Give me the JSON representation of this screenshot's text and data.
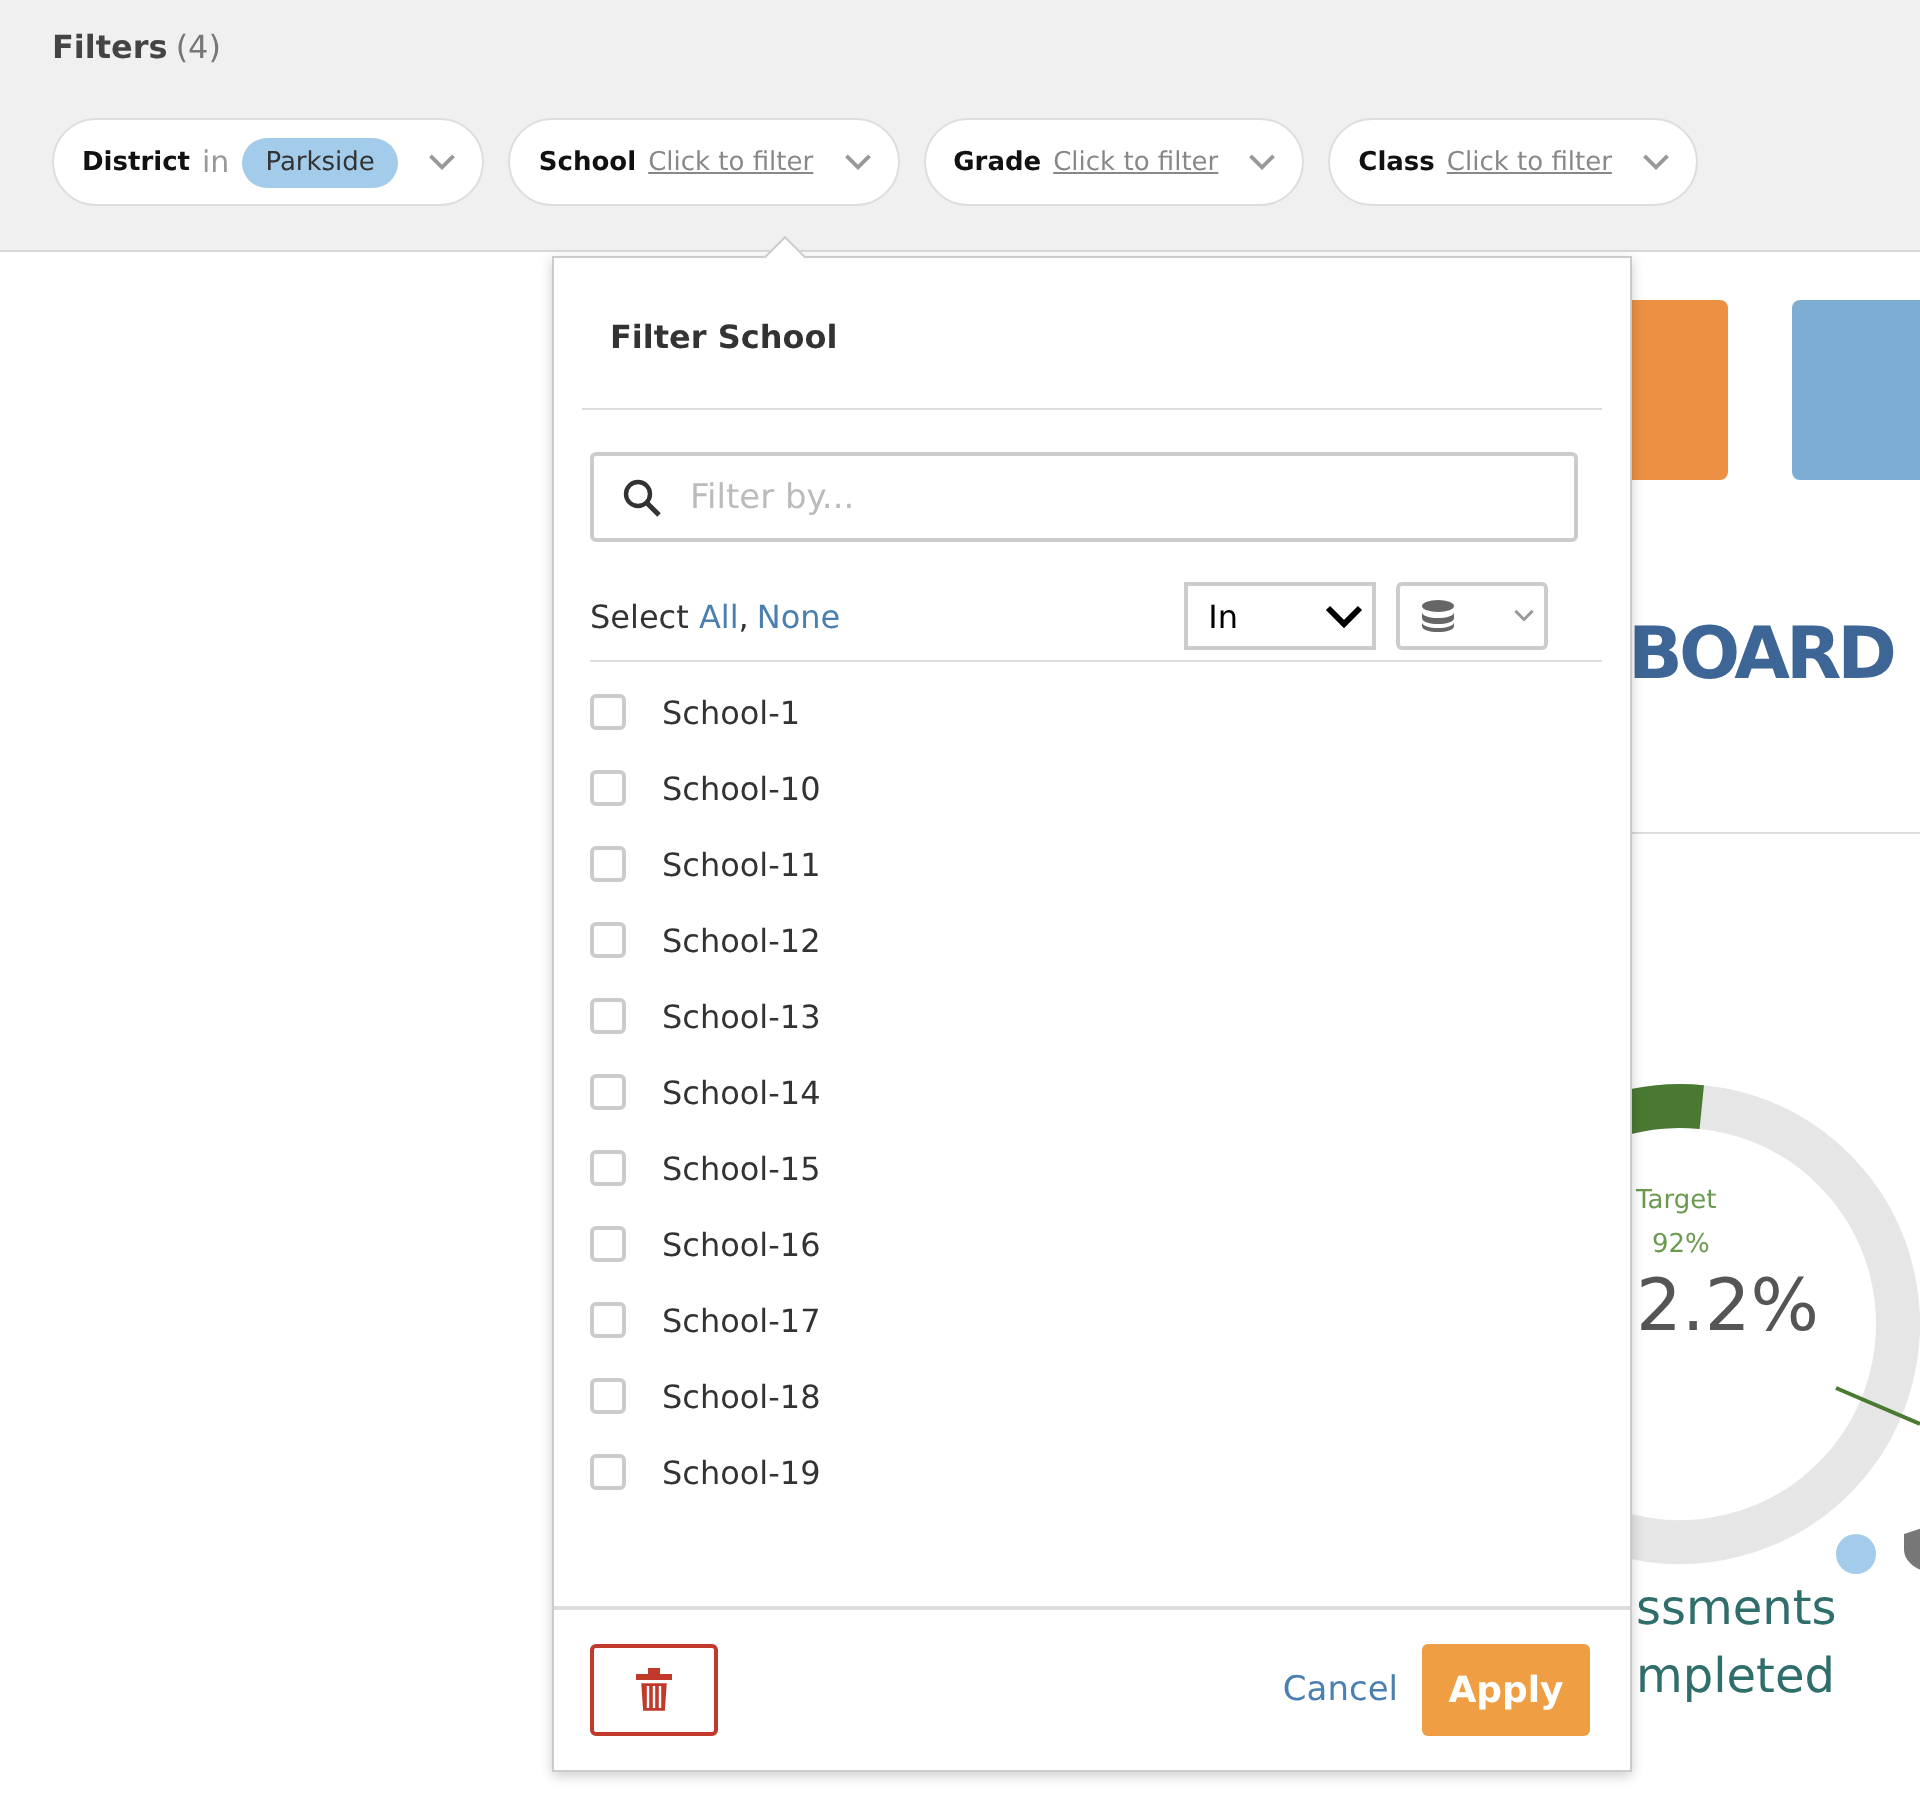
{
  "header": {
    "title": "Filters",
    "count": "(4)"
  },
  "filters": [
    {
      "field": "District",
      "operator": "in",
      "values": [
        "Parkside"
      ]
    },
    {
      "field": "School",
      "placeholder": "Click to filter"
    },
    {
      "field": "Grade",
      "placeholder": "Click to filter"
    },
    {
      "field": "Class",
      "placeholder": "Click to filter"
    }
  ],
  "popup": {
    "title": "Filter School",
    "search": {
      "placeholder": "Filter by..."
    },
    "select_label": "Select",
    "select_all": "All",
    "select_separator": ",",
    "select_none": "None",
    "operator": "In",
    "options": [
      {
        "label": "School-1",
        "checked": false
      },
      {
        "label": "School-10",
        "checked": false
      },
      {
        "label": "School-11",
        "checked": false
      },
      {
        "label": "School-12",
        "checked": false
      },
      {
        "label": "School-13",
        "checked": false
      },
      {
        "label": "School-14",
        "checked": false
      },
      {
        "label": "School-15",
        "checked": false
      },
      {
        "label": "School-16",
        "checked": false
      },
      {
        "label": "School-17",
        "checked": false
      },
      {
        "label": "School-18",
        "checked": false
      },
      {
        "label": "School-19",
        "checked": false
      }
    ],
    "cancel": "Cancel",
    "apply": "Apply"
  },
  "dashboard": {
    "heading": "BOARD",
    "gauge": {
      "target_label": "Target",
      "target_value": "92%",
      "value": "2.2%"
    },
    "caption_lines": [
      "ssments",
      "mpleted"
    ]
  }
}
